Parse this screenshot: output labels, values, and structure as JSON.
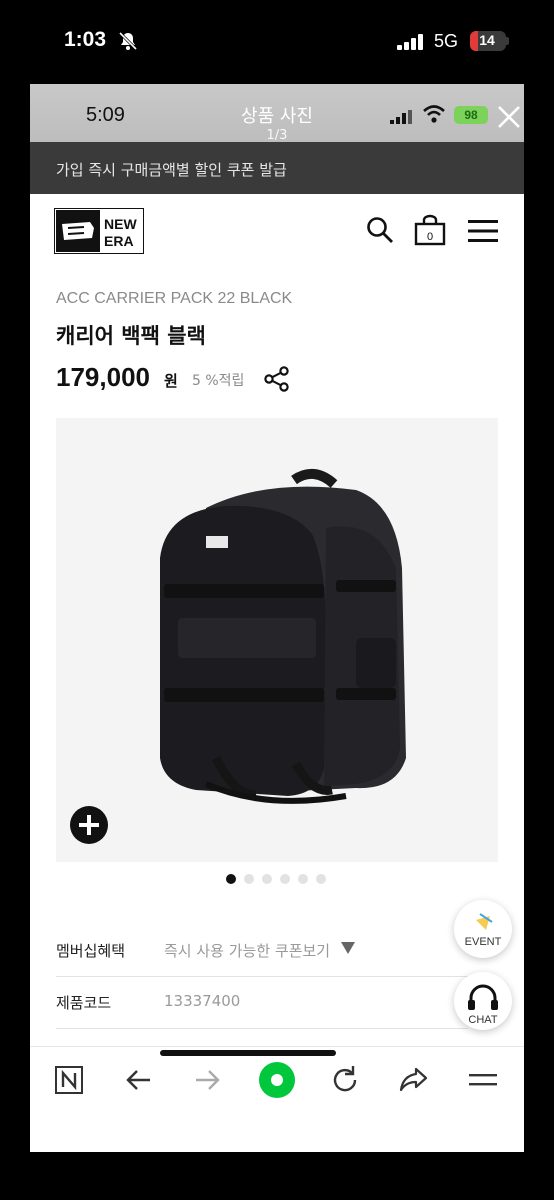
{
  "outer_status": {
    "time": "1:03",
    "network": "5G",
    "battery": "14"
  },
  "viewer": {
    "time": "5:09",
    "title": "상품 사진",
    "counter": "1/3",
    "battery": "98"
  },
  "promo": {
    "text": "가입 즉시 구매금액별 할인 쿠폰 발급"
  },
  "header": {
    "logo_top": "NEW",
    "logo_bottom": "ERA",
    "cart_count": "0"
  },
  "product": {
    "sku_name": "ACC CARRIER PACK 22 BLACK",
    "title": "캐리어 백팩 블랙",
    "price": "179,000",
    "currency": "원",
    "points": "5 %적립"
  },
  "gallery": {
    "total_dots": 6,
    "active_dot": 0
  },
  "info": {
    "membership_label": "멤버십혜택",
    "membership_value": "즉시 사용 가능한 쿠폰보기",
    "code_label": "제품코드",
    "code_value": "13337400"
  },
  "floating": {
    "event_label": "EVENT",
    "chat_label": "CHAT"
  },
  "colors": {
    "brand_green": "#00c73c",
    "promo_bg": "#3a3a3a"
  }
}
